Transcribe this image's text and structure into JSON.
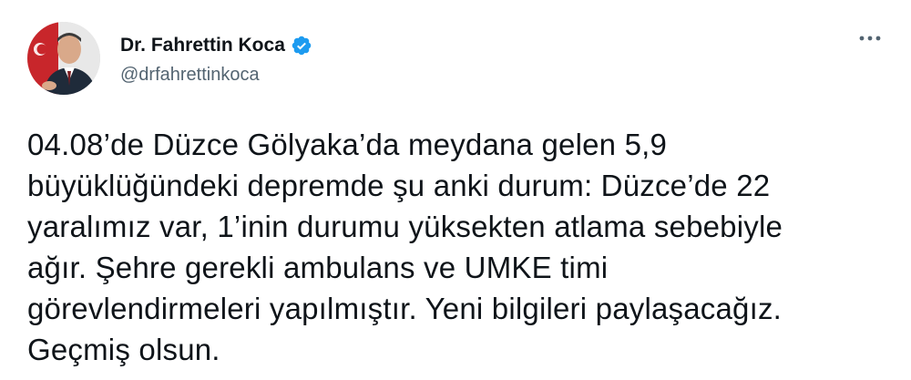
{
  "author": {
    "name": "Dr. Fahrettin Koca",
    "handle": "@drfahrettinkoca",
    "verified": true,
    "avatar_icon": "profile-photo"
  },
  "menu": {
    "icon": "more-options-icon"
  },
  "tweet": {
    "text": "04.08’de Düzce Gölyaka’da meydana gelen 5,9\nbüyüklüğündeki depremde şu anki durum: Düzce’de 22\nyaralımız var, 1’inin durumu yüksekten atlama sebebiyle\nağır. Şehre gerekli ambulans ve UMKE timi\ngörevlendirmeleri yapılmıştır. Yeni bilgileri paylaşacağız.\nGeçmiş olsun."
  },
  "colors": {
    "verified_blue": "#1d9bf0",
    "handle_gray": "#536471",
    "text": "#0f1419"
  }
}
